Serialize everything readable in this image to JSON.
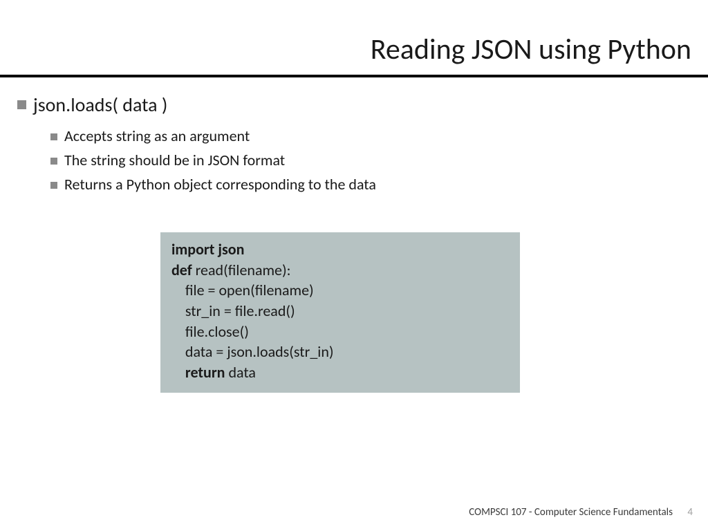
{
  "title": "Reading JSON using Python",
  "main_bullet": "json.loads( data )",
  "sub_bullets": [
    "Accepts string as an argument",
    "The string should be in JSON format",
    "Returns a Python object corresponding to the data"
  ],
  "code": {
    "l1a": "import json",
    "l2a": "def ",
    "l2b": "read(filename):",
    "l3": "    file = open(filename)",
    "l4": "    str_in = file.read()",
    "l5": "    file.close()",
    "l6": "    data = json.loads(str_in)",
    "l7a": "    ",
    "l7b": "return ",
    "l7c": "data"
  },
  "footer_text": "COMPSCI 107 - Computer Science Fundamentals",
  "page_number": "4"
}
